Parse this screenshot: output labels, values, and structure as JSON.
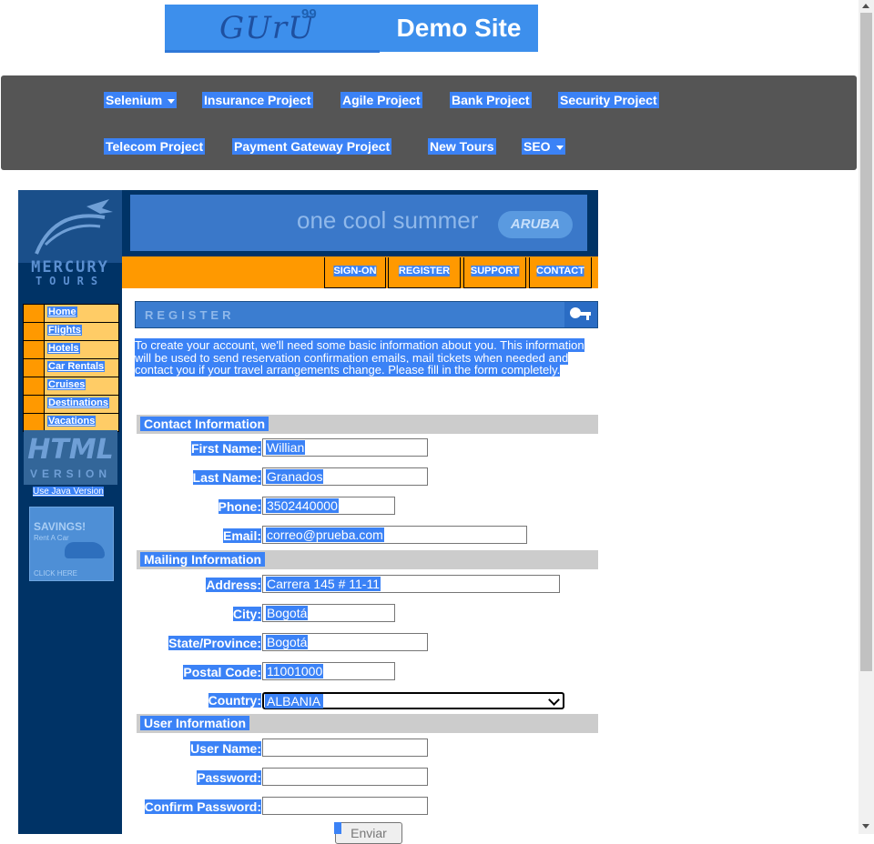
{
  "logo": {
    "guru": "GUrU",
    "guru_sup": "99",
    "demo": "Demo Site"
  },
  "nav": {
    "items": [
      {
        "label": "Selenium",
        "dropdown": true
      },
      {
        "label": "Insurance Project",
        "dropdown": false
      },
      {
        "label": "Agile Project",
        "dropdown": false
      },
      {
        "label": "Bank Project",
        "dropdown": false
      },
      {
        "label": "Security Project",
        "dropdown": false
      },
      {
        "label": "Telecom Project",
        "dropdown": false
      },
      {
        "label": "Payment Gateway Project",
        "dropdown": false
      },
      {
        "label": "New Tours",
        "dropdown": false
      },
      {
        "label": "SEO",
        "dropdown": true
      }
    ]
  },
  "mercury": {
    "brand": "MERCURY",
    "sub": "TOURS"
  },
  "banner": {
    "text": "one cool summer",
    "brand": "ARUBA"
  },
  "topbar": {
    "signon": "SIGN-ON",
    "register": "REGISTER",
    "support": "SUPPORT",
    "contact": "CONTACT"
  },
  "sidemenu": [
    "Home",
    "Flights",
    "Hotels",
    "Car Rentals",
    "Cruises",
    "Destinations",
    "Vacations"
  ],
  "html_version": {
    "line1": "HTML",
    "line2": "VERSION",
    "java_link": "Use Java Version"
  },
  "savings": {
    "title": "SAVINGS!",
    "sub": "Rent A Car",
    "cta": "CLICK HERE"
  },
  "register": {
    "title": "REGISTER",
    "intro": "To create your account, we'll need some basic information about you. This information will be used to send reservation confirmation emails, mail tickets when needed and contact you if your travel arrangements change. Please fill in the form completely."
  },
  "sections": {
    "contact": "Contact Information",
    "mailing": "Mailing Information",
    "user": "User Information"
  },
  "fields": {
    "first_name": {
      "label": "First Name:",
      "value": "Willian"
    },
    "last_name": {
      "label": "Last Name:",
      "value": "Granados"
    },
    "phone": {
      "label": "Phone:",
      "value": "3502440000"
    },
    "email": {
      "label": "Email:",
      "value": "correo@prueba.com"
    },
    "address": {
      "label": "Address:",
      "value": "Carrera 145 # 11-11"
    },
    "city": {
      "label": "City:",
      "value": "Bogotá"
    },
    "state": {
      "label": "State/Province:",
      "value": "Bogotá"
    },
    "postal": {
      "label": "Postal Code:",
      "value": "11001000"
    },
    "country": {
      "label": "Country:",
      "value": "ALBANIA"
    },
    "username": {
      "label": "User Name:",
      "value": ""
    },
    "password": {
      "label": "Password:",
      "value": ""
    },
    "confirm": {
      "label": "Confirm Password:",
      "value": ""
    }
  },
  "submit": {
    "label": "Enviar"
  },
  "colors": {
    "selection": "#3b82f6",
    "nav_bg": "#555555",
    "orange": "#ff9900",
    "navy": "#003366"
  }
}
